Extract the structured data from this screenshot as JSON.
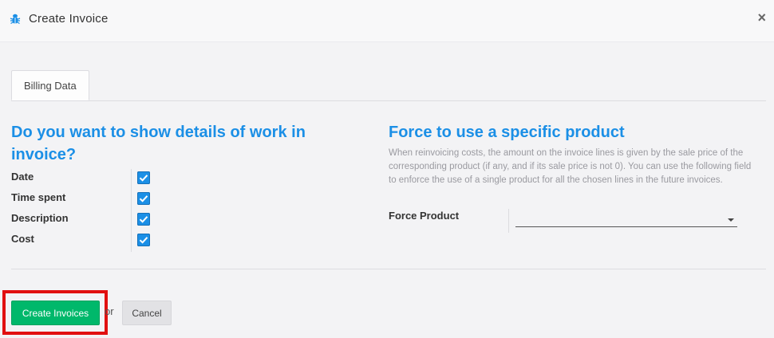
{
  "header": {
    "title": "Create Invoice",
    "close_label": "×",
    "icon": "bug-icon"
  },
  "tabs": [
    {
      "label": "Billing Data",
      "active": true
    }
  ],
  "details": {
    "title": "Do you want to show details of work in invoice?",
    "rows": [
      {
        "label": "Date",
        "checked": true
      },
      {
        "label": "Time spent",
        "checked": true
      },
      {
        "label": "Description",
        "checked": true
      },
      {
        "label": "Cost",
        "checked": true
      }
    ]
  },
  "force_product": {
    "title": "Force to use a specific product",
    "help": "When reinvoicing costs, the amount on the invoice lines is given by the sale price of the corresponding product (if any, and if its sale price is not 0). You can use the following field to enforce the use of a single product for all the chosen lines in the future invoices.",
    "field_label": "Force Product",
    "field_value": ""
  },
  "footer": {
    "create_label": "Create Invoices",
    "or_label": "or",
    "cancel_label": "Cancel"
  },
  "colors": {
    "accent": "#1b8fe6",
    "primary_button": "#00b86b",
    "highlight": "#e11010"
  }
}
